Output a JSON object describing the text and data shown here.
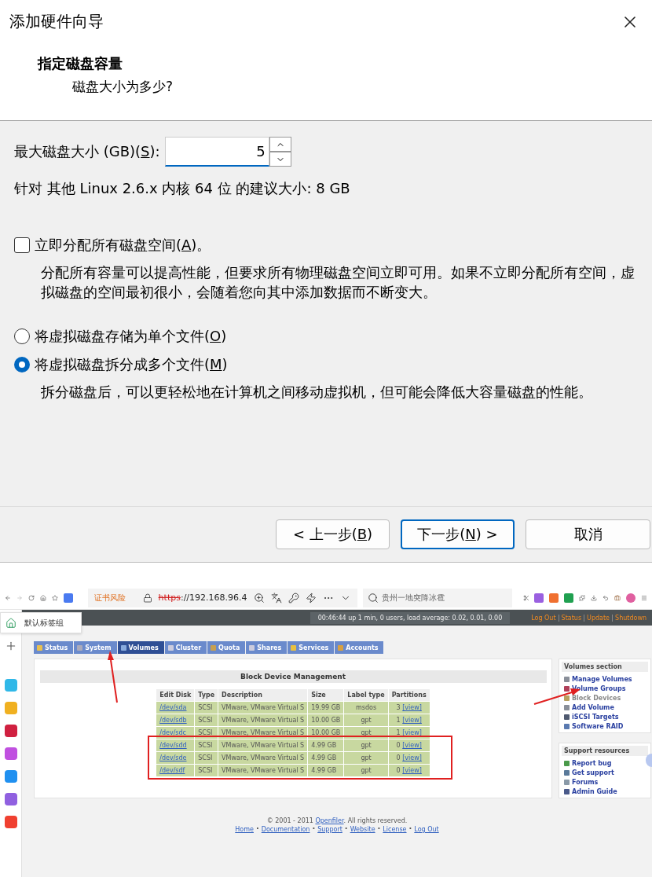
{
  "dialog": {
    "title": "添加硬件向导",
    "heading": "指定磁盘容量",
    "subheading": "磁盘大小为多少?",
    "size_field": {
      "label": {
        "text": "最大磁盘大小 (GB)(",
        "accel": "S",
        "after": "):"
      },
      "value": "5"
    },
    "recommendation": "针对 其他 Linux 2.6.x 内核 64 位 的建议大小: 8 GB",
    "allocate": {
      "label": {
        "text": "立即分配所有磁盘空间(",
        "accel": "A",
        "after": ")。"
      },
      "checked": false,
      "description": "分配所有容量可以提高性能，但要求所有物理磁盘空间立即可用。如果不立即分配所有空间，虚拟磁盘的空间最初很小，会随着您向其中添加数据而不断变大。"
    },
    "storage_options": [
      {
        "label": {
          "text": "将虚拟磁盘存储为单个文件(",
          "accel": "O",
          "after": ")"
        },
        "selected": false
      },
      {
        "label": {
          "text": "将虚拟磁盘拆分成多个文件(",
          "accel": "M",
          "after": ")"
        },
        "selected": true
      }
    ],
    "split_description": "拆分磁盘后，可以更轻松地在计算机之间移动虚拟机，但可能会降低大容量磁盘的性能。",
    "buttons": [
      {
        "label": {
          "text": "< 上一步(",
          "accel": "B",
          "after": ")"
        },
        "default": false
      },
      {
        "label": {
          "text": "下一步(",
          "accel": "N",
          "after": ") >"
        },
        "default": true
      },
      {
        "label": {
          "text": "取消"
        },
        "default": false
      }
    ]
  },
  "browser": {
    "cert_warning": "证书风险",
    "url": {
      "scheme": "https",
      "rest": "://192.168.96.4"
    },
    "search_placeholder": "贵州一地突降冰雹",
    "tab_group": "默认标签组",
    "page": {
      "uptime": "00:46:44 up 1 min, 0 users, load average: 0.02, 0.01, 0.00",
      "header_links": [
        "Log Out",
        "Status",
        "Update",
        "Shutdown"
      ],
      "tabs": [
        {
          "label": "Status",
          "selected": false
        },
        {
          "label": "System",
          "selected": false
        },
        {
          "label": "Volumes",
          "selected": true
        },
        {
          "label": "Cluster",
          "selected": false
        },
        {
          "label": "Quota",
          "selected": false
        },
        {
          "label": "Shares",
          "selected": false
        },
        {
          "label": "Services",
          "selected": false
        },
        {
          "label": "Accounts",
          "selected": false
        }
      ],
      "section_title": "Block Device Management",
      "table": {
        "columns": [
          "Edit Disk",
          "Type",
          "Description",
          "Size",
          "Label type",
          "Partitions"
        ],
        "rows": [
          {
            "disk": "/dev/sda",
            "type": "SCSI",
            "description": "VMware, VMware Virtual S",
            "size": "19.99 GB",
            "label_type": "msdos",
            "partitions": "3",
            "view": "[view]"
          },
          {
            "disk": "/dev/sdb",
            "type": "SCSI",
            "description": "VMware, VMware Virtual S",
            "size": "10.00 GB",
            "label_type": "gpt",
            "partitions": "1",
            "view": "[view]"
          },
          {
            "disk": "/dev/sdc",
            "type": "SCSI",
            "description": "VMware, VMware Virtual S",
            "size": "10.00 GB",
            "label_type": "gpt",
            "partitions": "1",
            "view": "[view]"
          },
          {
            "disk": "/dev/sdd",
            "type": "SCSI",
            "description": "VMware, VMware Virtual S",
            "size": "4.99 GB",
            "label_type": "gpt",
            "partitions": "0",
            "view": "[view]"
          },
          {
            "disk": "/dev/sde",
            "type": "SCSI",
            "description": "VMware, VMware Virtual S",
            "size": "4.99 GB",
            "label_type": "gpt",
            "partitions": "0",
            "view": "[view]"
          },
          {
            "disk": "/dev/sdf",
            "type": "SCSI",
            "description": "VMware, VMware Virtual S",
            "size": "4.99 GB",
            "label_type": "gpt",
            "partitions": "0",
            "view": "[view]"
          }
        ]
      },
      "volumes_section": {
        "title": "Volumes section",
        "items": [
          {
            "label": "Manage Volumes",
            "selected": false,
            "color": "#8a8f99"
          },
          {
            "label": "Volume Groups",
            "selected": false,
            "color": "#b0405a"
          },
          {
            "label": "Block Devices",
            "selected": true,
            "color": "#b8a060"
          },
          {
            "label": "Add Volume",
            "selected": false,
            "color": "#8a8f99"
          },
          {
            "label": "iSCSI Targets",
            "selected": false,
            "color": "#505a70"
          },
          {
            "label": "Software RAID",
            "selected": false,
            "color": "#5a7ab0"
          }
        ]
      },
      "support_section": {
        "title": "Support resources",
        "items": [
          {
            "label": "Report bug",
            "selected": false,
            "color": "#4a9a4a"
          },
          {
            "label": "Get support",
            "selected": false,
            "color": "#5a7a9a"
          },
          {
            "label": "Forums",
            "selected": false,
            "color": "#8a9aa8"
          },
          {
            "label": "Admin Guide",
            "selected": false,
            "color": "#4a5a8a"
          }
        ]
      },
      "footer": {
        "before": "© 2001 - 2011 ",
        "link": "Openfiler",
        "after": ". All rights reserved.",
        "separator": "·",
        "links": [
          "Home",
          "Documentation",
          "Support",
          "Website",
          "License",
          "Log Out"
        ]
      }
    }
  }
}
